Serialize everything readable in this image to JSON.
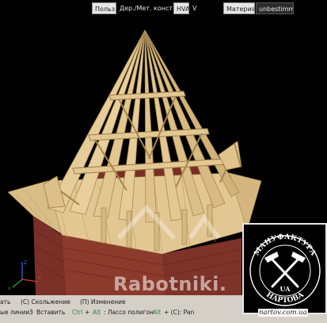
{
  "toolbar": {
    "user_label": "Польз.",
    "construction_label": "Дер./Мет. констр.",
    "hva_label": "HVA",
    "v_label": "V",
    "material_label": "Материал",
    "material_value": "unbestimmt"
  },
  "viewport": {
    "axis_z": "Z",
    "axis_x": "X",
    "axis_y": "Y"
  },
  "status": {
    "row1_left": "ать",
    "row1_slide": "(С) Скольжение",
    "row1_change": "(П) Изменение",
    "row2_lines": "ые линии",
    "row2_insert_key": "3",
    "row2_insert": "Вставить",
    "row2_ctrl": "Ctrl",
    "row2_plus1": "+",
    "row2_alt1": "Alt",
    "row2_lasso": ": Лассо полигон",
    "row2_alt2": "Alt",
    "row2_pan": "+ (С): Pan"
  },
  "watermark": {
    "site_text": "Rabotniki.",
    "logo_top": "МАНУФАКТУРА",
    "logo_bottom": "НАРТОВА",
    "logo_ua": "UA",
    "logo_url": "nartov.com.ua"
  },
  "colors": {
    "background": "#000000",
    "timber": "#e2c793",
    "timber_dark": "#b89a62",
    "brick": "#8c3a2c",
    "brick_dark": "#6a271d"
  }
}
